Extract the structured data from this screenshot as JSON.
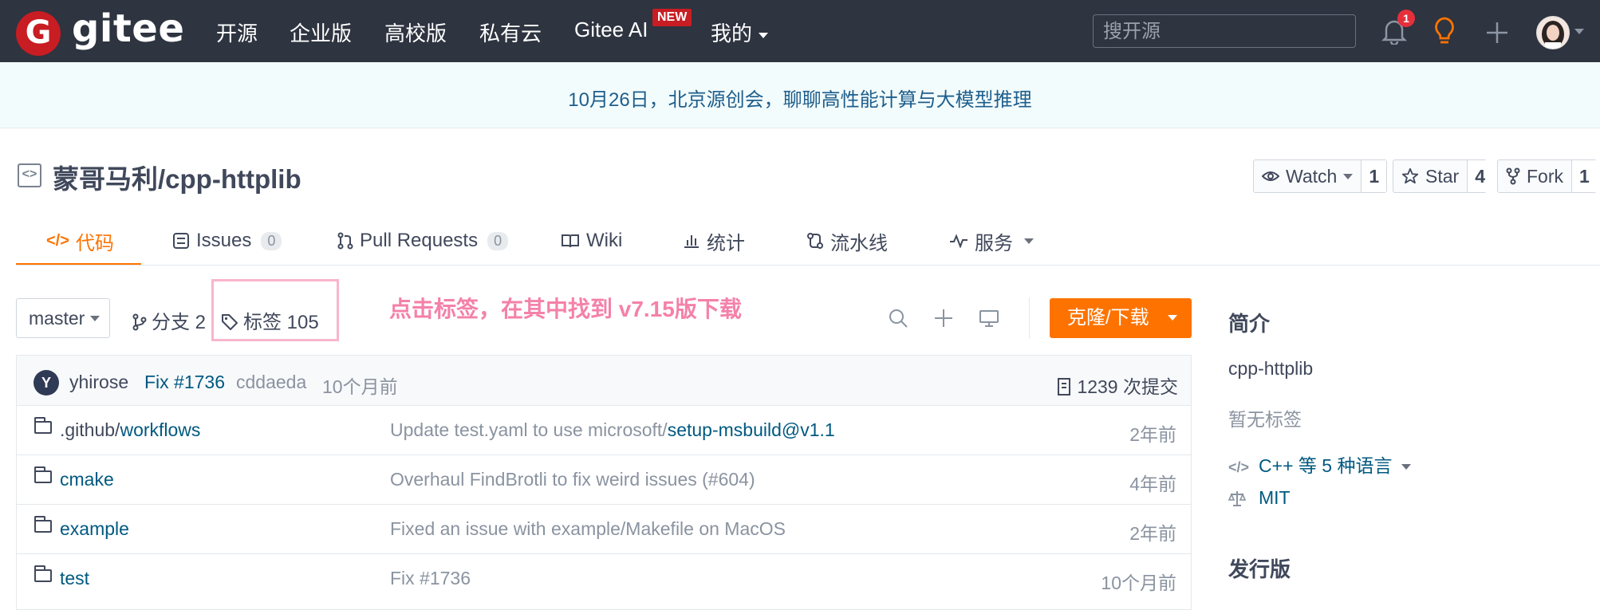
{
  "nav": {
    "brand": "gitee",
    "logo_letter": "G",
    "items": [
      "开源",
      "企业版",
      "高校版",
      "私有云",
      "Gitee AI"
    ],
    "new_badge": "NEW",
    "mine": "我的",
    "search_placeholder": "搜开源",
    "notification_count": "1"
  },
  "banner": "10月26日，北京源创会，聊聊高性能计算与大模型推理",
  "repo": {
    "title": "蒙哥马利/cpp-httplib",
    "watch_label": "Watch",
    "watch_count": "1",
    "star_label": "Star",
    "star_count": "4",
    "fork_label": "Fork",
    "fork_count": "1"
  },
  "tabs": [
    {
      "label": "代码"
    },
    {
      "label": "Issues",
      "badge": "0"
    },
    {
      "label": "Pull Requests",
      "badge": "0"
    },
    {
      "label": "Wiki"
    },
    {
      "label": "统计"
    },
    {
      "label": "流水线"
    },
    {
      "label": "服务"
    }
  ],
  "toolbar": {
    "branch": "master",
    "branches": "分支 2",
    "tags": "标签 105",
    "annotation": "点击标签，在其中找到 v7.15版下载",
    "clone_label": "克隆/下载"
  },
  "commit": {
    "avatar_letter": "Y",
    "author": "yhirose",
    "message": "Fix #1736",
    "hash": "cddaeda",
    "time": "10个月前",
    "total": "1239 次提交"
  },
  "files": [
    {
      "name_dim": ".github/",
      "name": "workflows",
      "msg": "Update test.yaml to use microsoft/",
      "msg_link": "setup-msbuild@v1.1",
      "time": "2年前"
    },
    {
      "name_dim": "",
      "name": "cmake",
      "msg": "Overhaul FindBrotli to fix weird issues (#604)",
      "msg_link": "",
      "time": "4年前"
    },
    {
      "name_dim": "",
      "name": "example",
      "msg": "Fixed an issue with example/Makefile on MacOS",
      "msg_link": "",
      "time": "2年前"
    },
    {
      "name_dim": "",
      "name": "test",
      "msg": "Fix #1736",
      "msg_link": "",
      "time": "10个月前"
    }
  ],
  "sidebar": {
    "intro_heading": "简介",
    "description": "cpp-httplib",
    "no_tags": "暂无标签",
    "languages": "C++ 等 5 种语言",
    "license": "MIT",
    "releases_heading": "发行版"
  },
  "colors": {
    "nav_bg": "#2e3440",
    "brand_red": "#c71d23",
    "accent_orange": "#fe7300",
    "link_blue": "#005980",
    "annotation_pink": "#f481a9"
  }
}
